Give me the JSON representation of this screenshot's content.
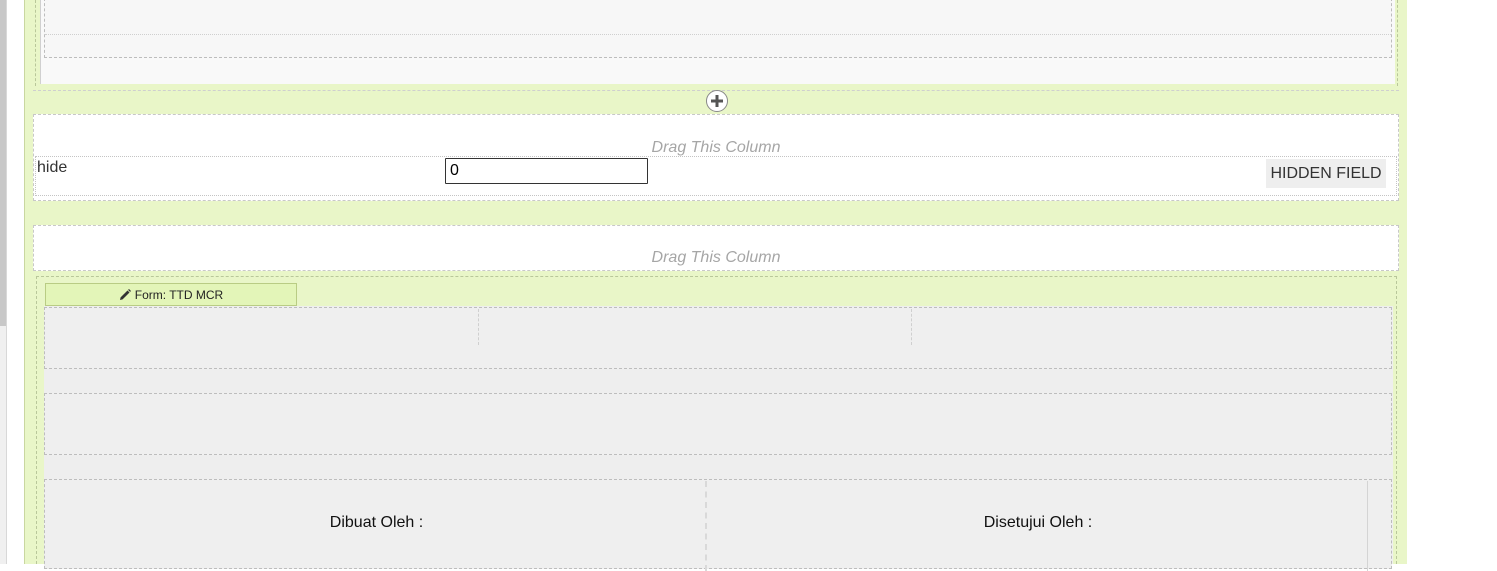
{
  "builder": {
    "add_section_icon": "plus-circle-icon",
    "drag_column_text": "Drag This Column",
    "hidden_row": {
      "label": "hide",
      "value": "0",
      "type_button": "HIDDEN FIELD"
    },
    "form_tab": {
      "icon": "pencil-icon",
      "label": "Form: TTD MCR"
    },
    "signature": {
      "made_by": "Dibuat Oleh :",
      "approved_by": "Disetujui Oleh :"
    }
  },
  "colors": {
    "section_bg": "#e9f6c8",
    "tab_bg": "#e3f5b8",
    "panel_gray": "#eeeeee"
  }
}
